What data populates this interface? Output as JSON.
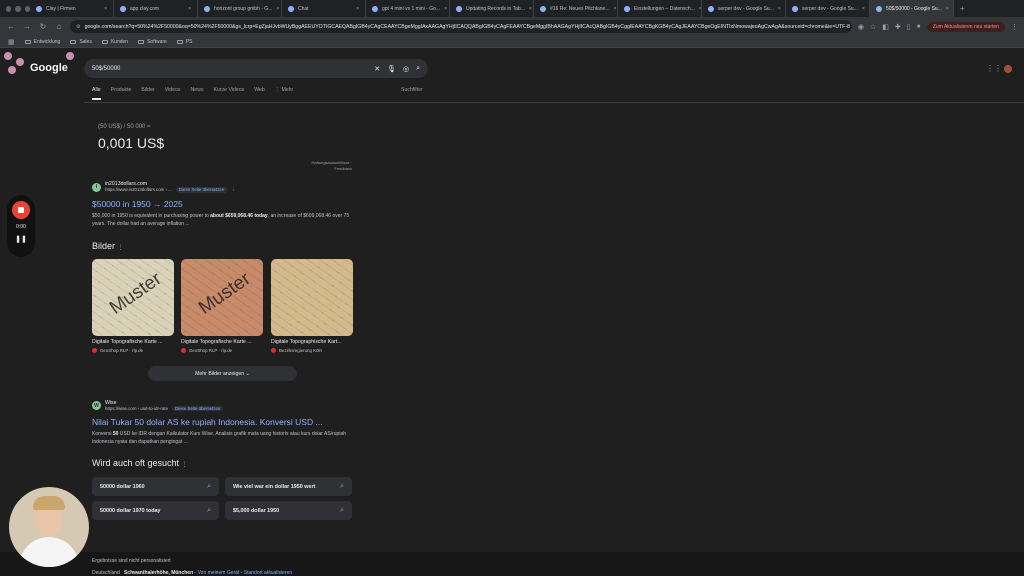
{
  "browser": {
    "tabs": [
      {
        "label": "Clay | Firmen",
        "active": false
      },
      {
        "label": "app.clay.com",
        "active": false
      },
      {
        "label": "horizont group gmbh - G...",
        "active": false
      },
      {
        "label": "Chat",
        "active": false
      },
      {
        "label": "gpt 4 mini vs 1 mini - Go...",
        "active": false
      },
      {
        "label": "Updating Records in Tab...",
        "active": false
      },
      {
        "label": "#16 Re: Neues Pitchlane...",
        "active": false
      },
      {
        "label": "Einstellungen – Datensch...",
        "active": false
      },
      {
        "label": "serper dev - Google Su...",
        "active": false
      },
      {
        "label": "serper dev - Google Su...",
        "active": false
      },
      {
        "label": "50$/50000 - Google Su...",
        "active": true
      }
    ],
    "new_tab": "+",
    "address": "google.com/search?q=50%24%2F50000&oq=50%24%2F50000&gs_lcrp=EgZjaHJvbWUyBggAEEUYOTIGCAEQABgIGB4yCAgCEAAYCBgeMggIAxAAGAgYHjIICAQQABgIGB4yCAgFEAAYCBgeMggIBhAAGAgYHjIICAcQABgIGB4yCggIEAAYCBgKGB4yCAgJEAAYCBgeOgEINTIxNmowajeoAgCwAgA&sourceid=chrome&ie=UTF-8",
    "update_label": "Zum Aktualisieren neu starten",
    "bookmarks": [
      "Entwicklung",
      "Sales",
      "Kunden",
      "Software",
      "PS"
    ]
  },
  "google": {
    "logo": "Google",
    "query": "50$/50000",
    "nav_tabs": [
      "Alle",
      "Produkte",
      "Bilder",
      "Videos",
      "News",
      "Kurze Videos",
      "Web",
      "Mehr"
    ],
    "tools": "Suchfilter"
  },
  "conversion": {
    "expression": "(50 US$) / 50 000 =",
    "result": "0,001 US$",
    "disclaimer_1": "Haftungsausschlüsse ·",
    "disclaimer_2": "Feedback"
  },
  "results": [
    {
      "source_icon": "I",
      "source_name": "in2013dollars.com",
      "source_url": "https://www.in2013dollars.com › ...",
      "translate_label": "Diese Seite übersetzen",
      "title": "$50000 in 1950 → 2025",
      "snippet_pre": "$50,000 in 1950 is equivalent in purchasing power to ",
      "snippet_bold": "about $659,068.46 today",
      "snippet_post": ", an increase of $609,068.46 over 75 years. The dollar had an average inflation ..."
    },
    {
      "source_icon": "W",
      "source_name": "Wise",
      "source_url": "https://wise.com › usd-to-idr-rate",
      "translate_label": "Diese Seite übersetzen",
      "title": "Nilai Tukar 50 dolar AS ke rupiah Indonesia. Konversi USD ...",
      "snippet_pre": "Konversi ",
      "snippet_bold": "50",
      "snippet_post": " USD ke IDR dengan Kalkulator Kurs Wise. Analisis grafik mata uang historis atau kurs dolar AS/rupiah Indonesia nyata dan dapatkan pengingat ..."
    }
  ],
  "images": {
    "heading": "Bilder",
    "more_label": "Mehr Bilder anzeigen",
    "cards": [
      {
        "title": "Digitale Topografische Karte ...",
        "source": "GeoShop RLP · rlp.de",
        "watermark": "Muster",
        "color": "#d9d2b8"
      },
      {
        "title": "Digitale Topografische Karte ...",
        "source": "GeoShop RLP · rlp.de",
        "watermark": "Muster",
        "color": "#c98a6a"
      },
      {
        "title": "Digitale Topographische Kart...",
        "source": "Bezirksregierung Köln",
        "watermark": "",
        "color": "#d4b98c"
      }
    ]
  },
  "related": {
    "heading": "Wird auch oft gesucht",
    "items": [
      "50000 dollar 1960",
      "Wie viel war ein dollar 1950 wert",
      "50000 dollar 1970 today",
      "$5,000 dollar 1950"
    ]
  },
  "footer": {
    "personalized": "Ergebnisse sind nicht personalisiert",
    "country": "Deutschland",
    "location": "Schwanthalerhöhe, München",
    "from_device": "Von meinem Gerät",
    "update_location": "Standort aktualisieren"
  },
  "recorder": {
    "time": "0:00"
  }
}
